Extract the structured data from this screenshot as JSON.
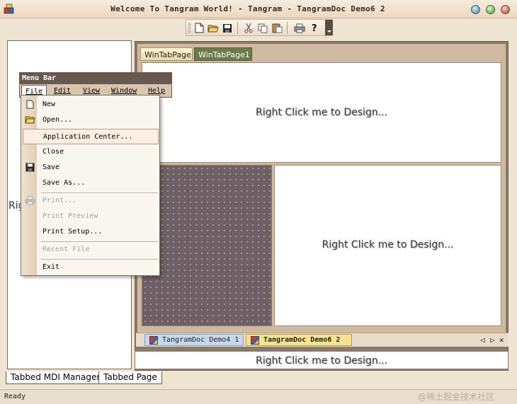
{
  "window": {
    "title": "Welcome To Tangram World! - Tangram - TangramDoc Demo6 2"
  },
  "toolbar": {
    "buttons": [
      "new-icon",
      "open-icon",
      "save-icon",
      "cut-icon",
      "copy-icon",
      "paste-icon",
      "print-icon",
      "help-icon"
    ]
  },
  "left_panel": {
    "partial_text": "Rig",
    "tabs": [
      "Tabbed MDI Manager",
      "Tabbed Page"
    ]
  },
  "win_tabs": [
    "WinTabPage",
    "WinTabPage1"
  ],
  "panels": {
    "top_text": "Right Click me to Design...",
    "right_text": "Right Click me to Design...",
    "bottom_text": "Right Click me to Design..."
  },
  "doc_tabs": [
    "TangramDoc Demo4 1",
    "TangramDoc Demo6 2"
  ],
  "menu_bar": {
    "title": "Menu Bar",
    "items": [
      "File",
      "Edit",
      "View",
      "Window",
      "Help"
    ]
  },
  "file_menu": {
    "items": [
      {
        "label": "New",
        "icon": "new-icon",
        "enabled": true
      },
      {
        "label": "Open...",
        "icon": "open-icon",
        "enabled": true
      },
      {
        "label": "Application Center...",
        "enabled": true,
        "highlighted": true
      },
      {
        "label": "Close",
        "enabled": true
      },
      {
        "label": "Save",
        "icon": "save-icon",
        "enabled": true
      },
      {
        "label": "Save As...",
        "enabled": true
      },
      {
        "label": "Print...",
        "icon": "print-icon",
        "enabled": false
      },
      {
        "label": "Print Preview",
        "enabled": false
      },
      {
        "label": "Print Setup...",
        "enabled": true
      },
      {
        "label": "Recent File",
        "enabled": false
      },
      {
        "label": "Exit",
        "enabled": true
      }
    ]
  },
  "status": {
    "text": "Ready",
    "watermark": "@稀土掘金技术社区"
  },
  "colors": {
    "frame": "#efe3d2",
    "accent_tab": "#6a7a4a",
    "active_doc_tab": "#f6e38f",
    "menu_title": "#675850"
  }
}
